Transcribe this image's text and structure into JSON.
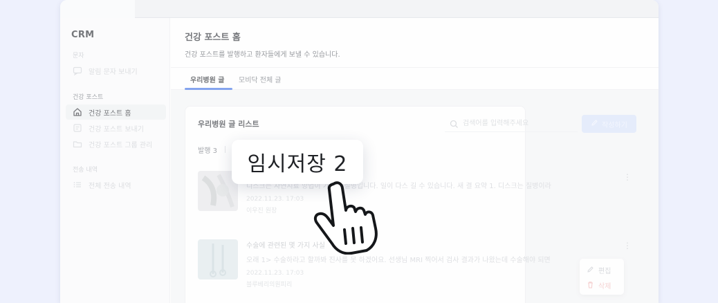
{
  "app": {
    "brand": "CRM"
  },
  "sidebar": {
    "sections": [
      {
        "label": "문자",
        "items": [
          {
            "label": "알림 문자 보내기",
            "icon": "message-icon"
          }
        ]
      },
      {
        "label": "건강 포스트",
        "items": [
          {
            "label": "건강 포스트 홈",
            "icon": "home-icon",
            "active": true
          },
          {
            "label": "건강 포스트 보내기",
            "icon": "send-post-icon"
          },
          {
            "label": "건강 포스트 그룹 관리",
            "icon": "folder-icon"
          }
        ]
      },
      {
        "label": "전송 내역",
        "items": [
          {
            "label": "전체 전송 내역",
            "icon": "list-icon"
          }
        ]
      }
    ]
  },
  "header": {
    "title": "건강 포스트 홈",
    "subtitle": "건강 포스트를 발행하고 환자들에게 보낼 수 있습니다."
  },
  "tabs": [
    {
      "label": "우리병원 글",
      "active": true
    },
    {
      "label": "모비닥 전체 글",
      "active": false
    }
  ],
  "list": {
    "title": "우리병원 글 리스트",
    "search_placeholder": "검색어를 입력해주세요",
    "write_label": "작성하기",
    "filter_label": "발행 3",
    "posts": [
      {
        "title": "",
        "body": "디스크는 자연치료 방법이 가능한 질병입니다. 일이 다스 길 수 있습니다. 새 결 요약 1. 디스크는 질병이라",
        "date": "2022.11.23. 17:03",
        "author": "이우진 원장"
      },
      {
        "title": "수술에 관련된 몇 가지 사실",
        "body": "오래 1> 수술하라고 할까봐 진사를 못 하겠어요. 선생님 MRI 찍어서 검사 결과가 나왔는데 수술해야 되면",
        "date": "2022.11.23. 17:03",
        "author": "블루베리의원피리"
      }
    ],
    "menu": {
      "edit_label": "편집",
      "delete_label": "삭제"
    }
  },
  "tooltip": {
    "label": "임시저장 2"
  },
  "colors": {
    "accent": "#3b6fe5",
    "background": "#eef1fd",
    "delete": "#f0b9b9"
  }
}
